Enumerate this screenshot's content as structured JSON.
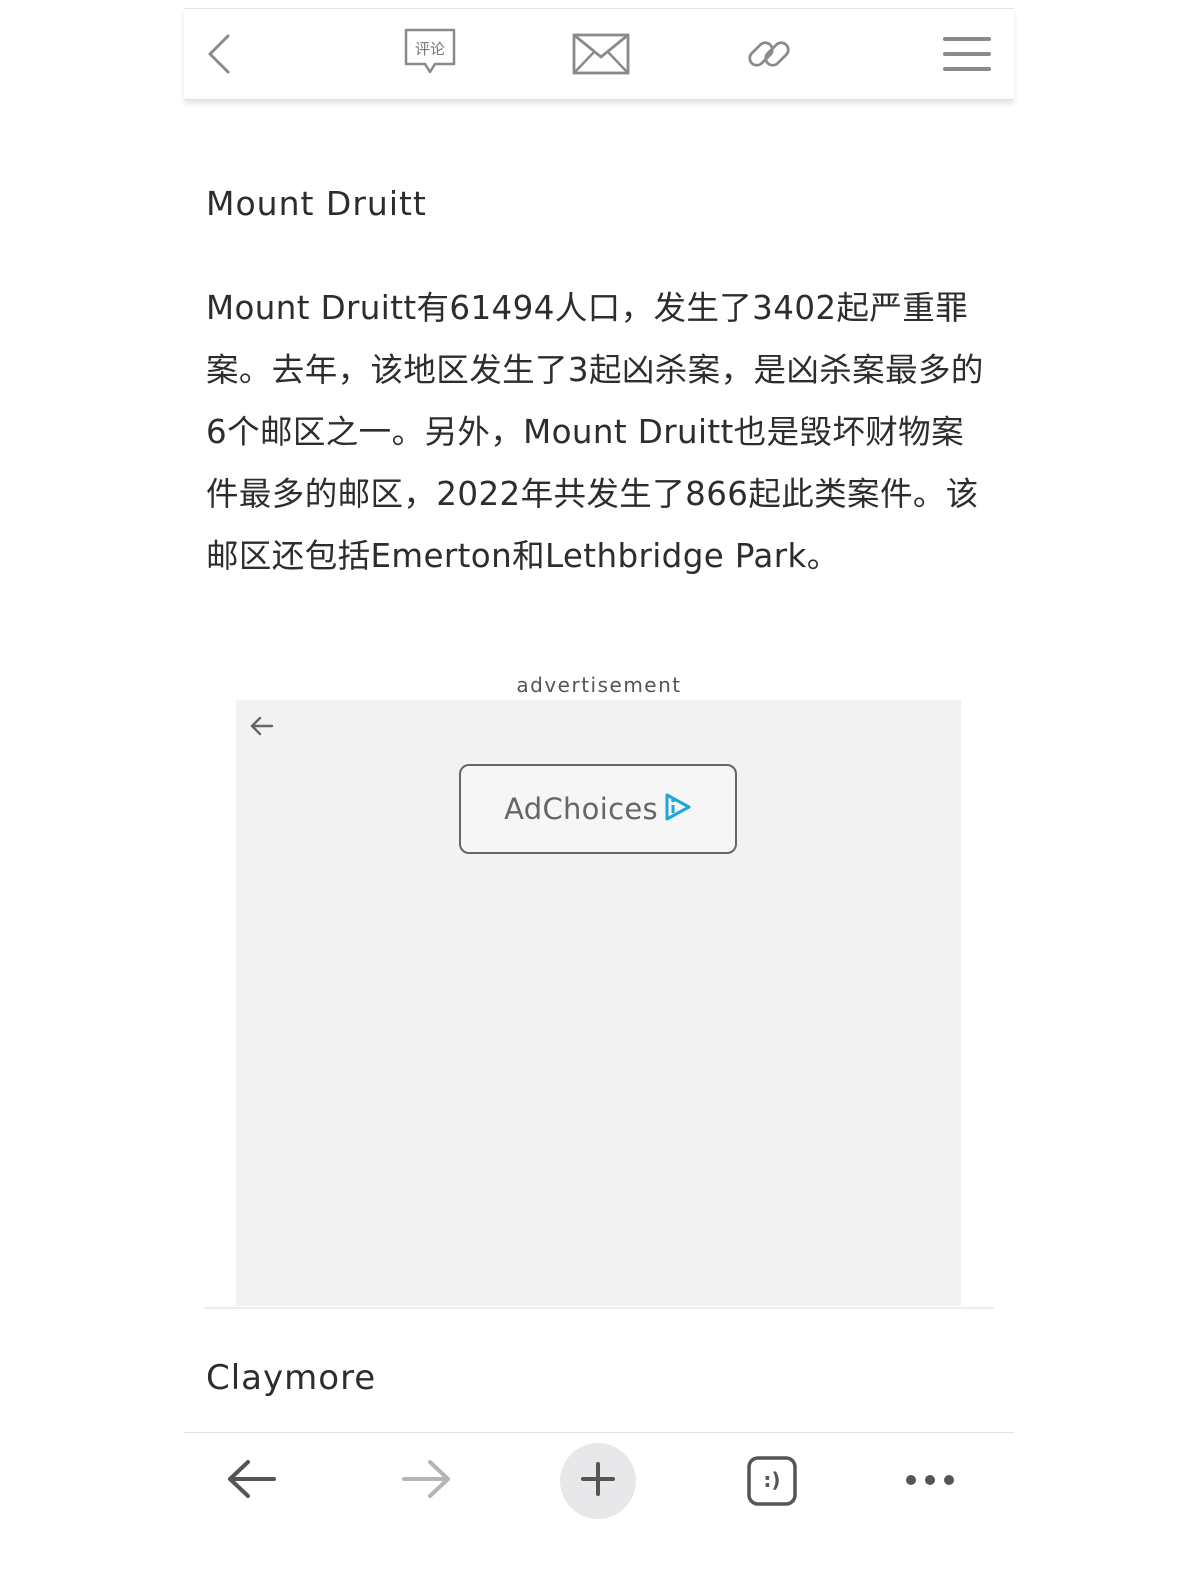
{
  "toolbar": {
    "back_icon": "chevron-left-icon",
    "comment_label": "评论",
    "mail_icon": "envelope-icon",
    "link_icon": "link-icon",
    "menu_icon": "hamburger-menu-icon"
  },
  "article": {
    "section_title": "Mount Druitt",
    "body": "Mount Druitt有61494人口，发生了3402起严重罪案。去年，该地区发生了3起凶杀案，是凶杀案最多的6个邮区之一。另外，Mount Druitt也是毁坏财物案件最多的邮区，2022年共发生了866起此类案件。该邮区还包括Emerton和Lethbridge Park。",
    "next_section_title": "Claymore"
  },
  "ad": {
    "label": "advertisement",
    "adchoices_label": "AdChoices",
    "adchoices_color": "#1fa8d6"
  },
  "browser_bar": {
    "back_icon": "arrow-left-icon",
    "forward_icon": "arrow-right-icon",
    "new_tab_icon": "plus-icon",
    "tabs_icon": "tabs-smiley-icon",
    "tabs_glyph": ":)",
    "more_icon": "more-dots-icon"
  }
}
